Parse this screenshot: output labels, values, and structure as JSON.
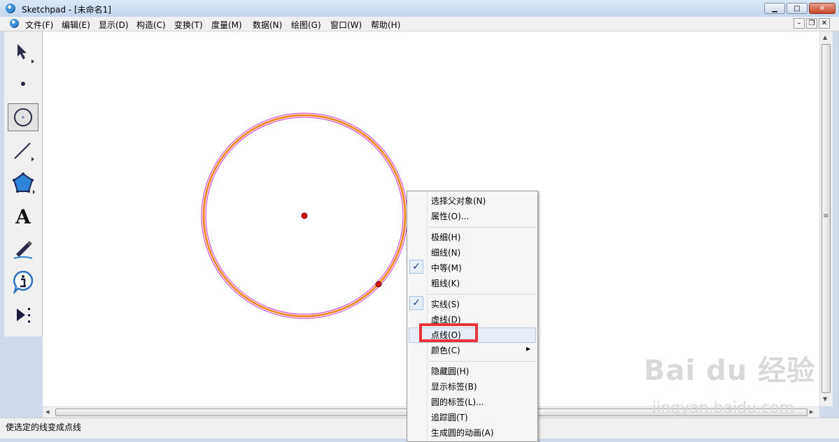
{
  "window": {
    "title": "Sketchpad  - [未命名1]",
    "minimize": "▁",
    "maximize": "□",
    "close": "✕"
  },
  "menu": {
    "items": [
      "文件(F)",
      "编辑(E)",
      "显示(D)",
      "构造(C)",
      "变换(T)",
      "度量(M)",
      "数据(N)",
      "绘图(G)",
      "窗口(W)",
      "帮助(H)"
    ],
    "mdi_minimize": "–",
    "mdi_restore": "❐",
    "mdi_close": "✕"
  },
  "toolbox": {
    "tools": [
      "arrow-tool",
      "point-tool",
      "compass-tool",
      "straightedge-tool",
      "polygon-tool",
      "text-tool",
      "marker-tool",
      "information-tool",
      "custom-tool"
    ],
    "active": "compass-tool",
    "text_tool_glyph": "A"
  },
  "canvas": {
    "circle_color": "#f08a28",
    "highlight_color": "#cc33cc",
    "point_color": "#d21414"
  },
  "context_menu": {
    "items": [
      "选择父对象(N)",
      "属性(O)...",
      "极细(H)",
      "细线(N)",
      "中等(M)",
      "粗线(K)",
      "实线(S)",
      "虚线(D)",
      "点线(O)",
      "颜色(C)",
      "隐藏圆(H)",
      "显示标签(B)",
      "圆的标签(L)...",
      "追踪圆(T)",
      "生成圆的动画(A)"
    ],
    "checked": [
      "中等(M)",
      "实线(S)"
    ],
    "highlighted": "点线(O)",
    "check_glyph": "✓",
    "submenu_arrow": "▸"
  },
  "scrollbars": {
    "up": "▲",
    "down": "▼",
    "left": "◂",
    "right": "▸",
    "grip": "≡"
  },
  "status": {
    "text": "使选定的线变成点线"
  },
  "watermark": {
    "line1": "Bai du 经验",
    "line2": "jingyan.baidu.com"
  }
}
